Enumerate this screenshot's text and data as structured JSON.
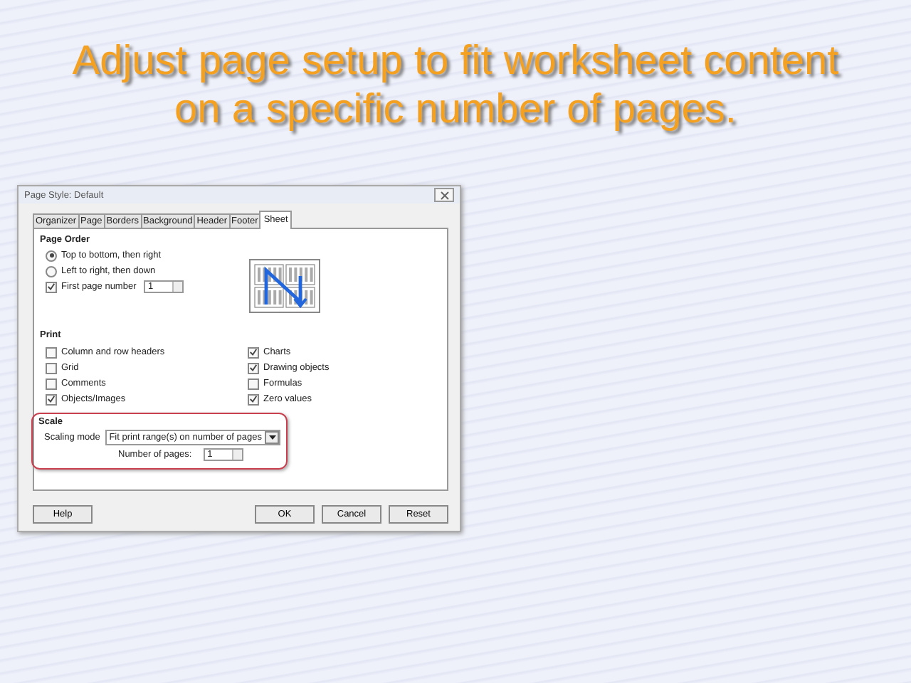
{
  "slide_title": "Adjust page setup to fit worksheet content on a specific number of pages.",
  "dialog": {
    "title": "Page Style: Default",
    "tabs": [
      {
        "label": "Organizer",
        "selected": false
      },
      {
        "label": "Page",
        "selected": false
      },
      {
        "label": "Borders",
        "selected": false
      },
      {
        "label": "Background",
        "selected": false
      },
      {
        "label": "Header",
        "selected": false
      },
      {
        "label": "Footer",
        "selected": false
      },
      {
        "label": "Sheet",
        "selected": true
      }
    ],
    "page_order": {
      "heading": "Page Order",
      "options": [
        {
          "label": "Top to bottom, then right",
          "selected": true
        },
        {
          "label": "Left to right, then down",
          "selected": false
        }
      ],
      "first_page": {
        "label": "First page number",
        "checked": true,
        "value": "1"
      }
    },
    "print": {
      "heading": "Print",
      "items": [
        {
          "label": "Column and row headers",
          "checked": false
        },
        {
          "label": "Charts",
          "checked": true
        },
        {
          "label": "Grid",
          "checked": false
        },
        {
          "label": "Drawing objects",
          "checked": true
        },
        {
          "label": "Comments",
          "checked": false
        },
        {
          "label": "Formulas",
          "checked": false
        },
        {
          "label": "Objects/Images",
          "checked": true
        },
        {
          "label": "Zero values",
          "checked": true
        }
      ]
    },
    "scale": {
      "heading": "Scale",
      "mode_label": "Scaling mode",
      "mode_value": "Fit print range(s) on number of pages",
      "pages_label": "Number of pages:",
      "pages_value": "1"
    },
    "buttons": [
      {
        "label": "Help",
        "kind": "left"
      },
      {
        "label": "OK",
        "kind": "right"
      },
      {
        "label": "Cancel",
        "kind": "right"
      },
      {
        "label": "Reset",
        "kind": "right"
      }
    ]
  }
}
